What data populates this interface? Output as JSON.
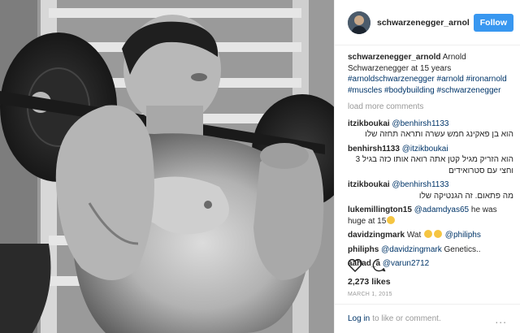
{
  "header": {
    "username": "schwarzenegger_arnol",
    "follow_label": "Follow"
  },
  "caption": {
    "user": "schwarzenegger_arnold",
    "text": "Arnold Schwarzenegger at 15 years",
    "hashtags": "#arnoldschwarzenegger #arnold #ironarnold #muscles #bodybuilding #schwarzenegger"
  },
  "load_more": "load more comments",
  "comments": [
    {
      "user": "itzikboukai",
      "mention": "@benhirsh1133",
      "text": "הוא בן פאקינג חמש עשרה ותראה תחזה שלו"
    },
    {
      "user": "benhirsh1133",
      "mention": "@itzikboukai",
      "text": "הוא הזריק מגיל קטן אתה רואה אותו כזה בגיל 3 וחצי עם סטרואידים"
    },
    {
      "user": "itzikboukai",
      "mention": "@benhirsh1133",
      "text": "מה פתאום. זה הגנטיקה שלו"
    },
    {
      "user": "lukemillington15",
      "mention": "@adamdyas65",
      "text": "he was huge at 15"
    },
    {
      "user": "davidzingmark",
      "text": "Wat",
      "mention": "@philiphs"
    },
    {
      "user": "philiphs",
      "mention": "@davidzingmark",
      "text": "Genetics.."
    },
    {
      "user": "aahad_a",
      "mention": "@varun2712"
    }
  ],
  "actions": {
    "like_icon": "heart-icon",
    "comment_icon": "comment-bubble-icon"
  },
  "likes": "2,273 likes",
  "date": "MARCH 1, 2015",
  "login_bar": {
    "link": "Log in",
    "rest": " to like or comment.",
    "more": "..."
  }
}
